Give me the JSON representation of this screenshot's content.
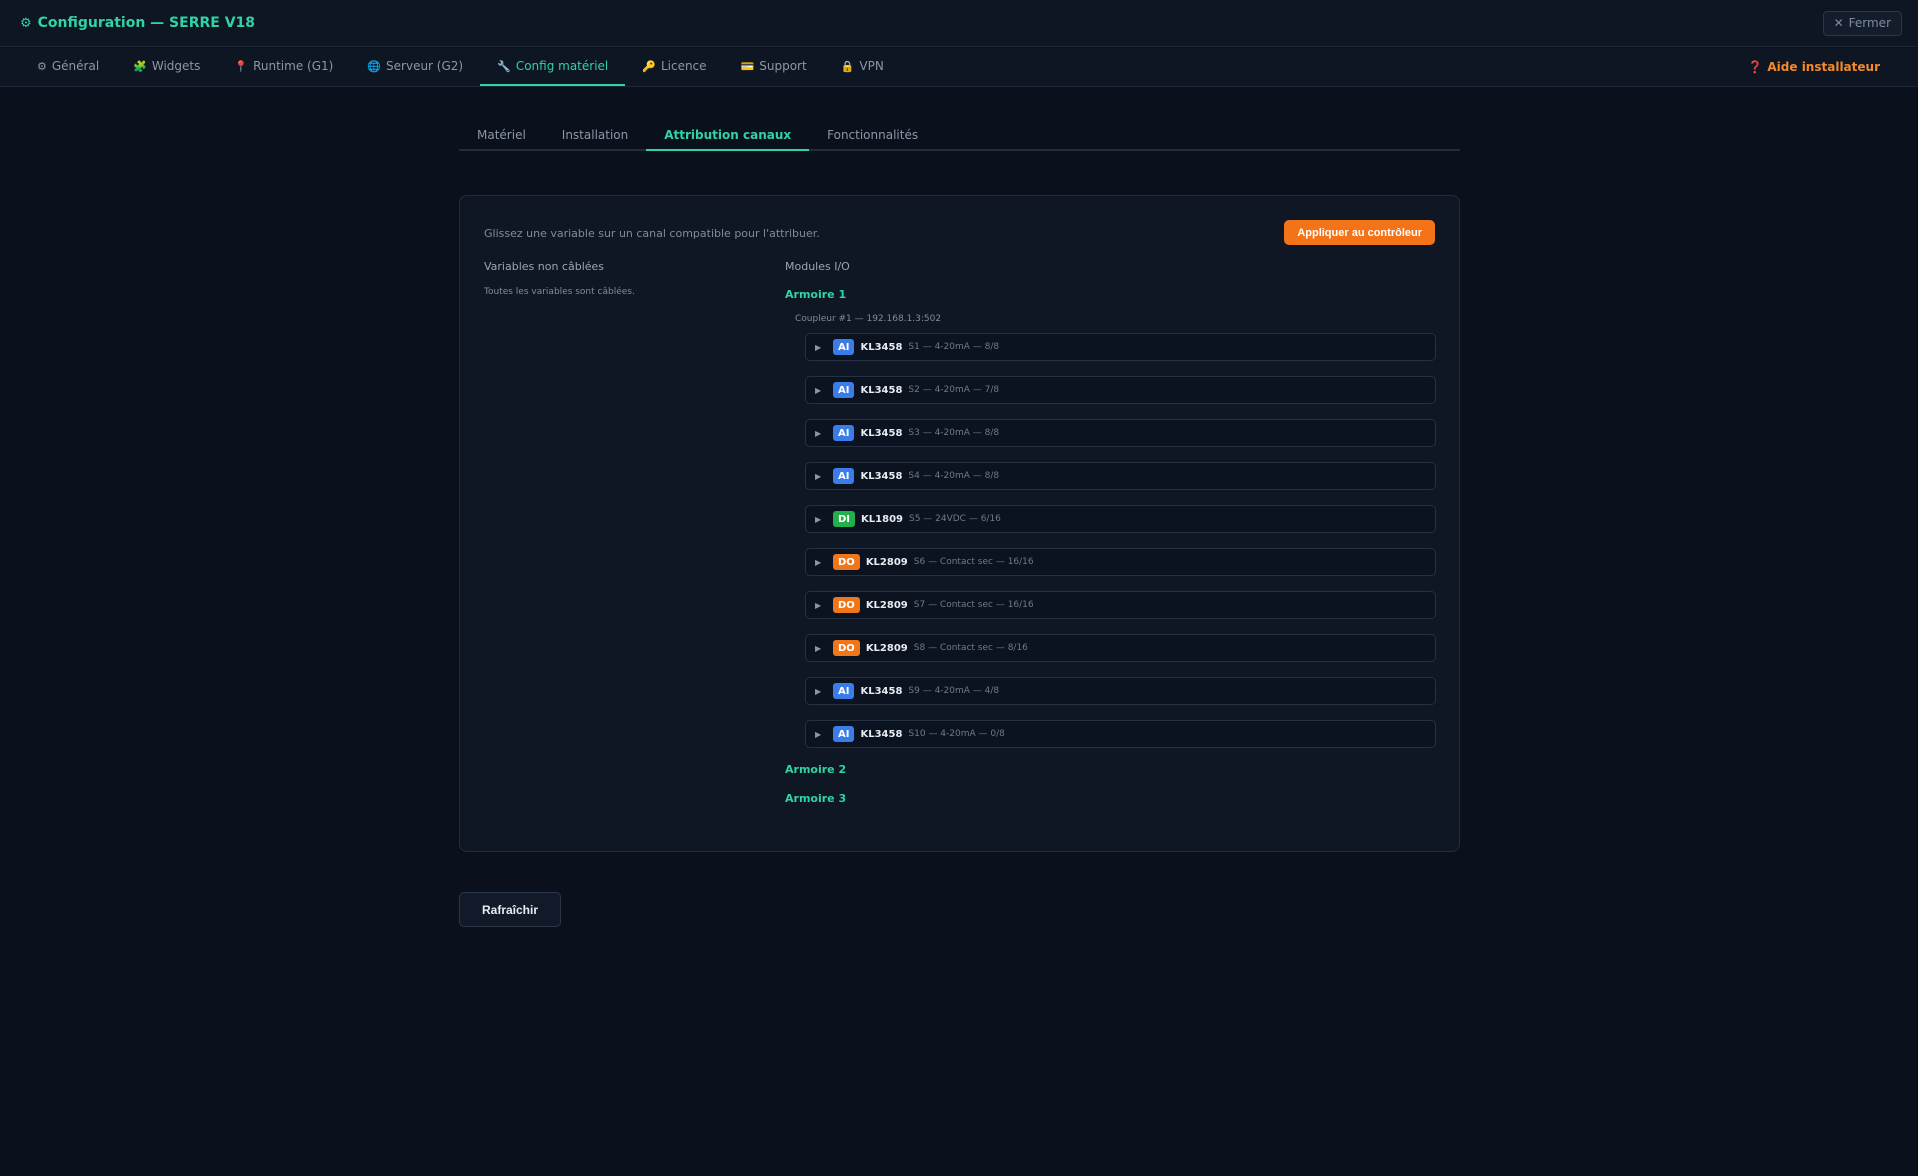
{
  "header": {
    "title": "Configuration — SERRE V18",
    "title_icon": "⚙",
    "close_label": "Fermer",
    "close_icon": "✕"
  },
  "topnav": {
    "tabs": [
      {
        "icon": "⚙",
        "label": "Général"
      },
      {
        "icon": "🧩",
        "label": "Widgets"
      },
      {
        "icon": "📍",
        "label": "Runtime (G1)"
      },
      {
        "icon": "🌐",
        "label": "Serveur (G2)"
      },
      {
        "icon": "🔧",
        "label": "Config matériel"
      },
      {
        "icon": "🔑",
        "label": "Licence"
      },
      {
        "icon": "💳",
        "label": "Support"
      },
      {
        "icon": "🔒",
        "label": "VPN"
      }
    ],
    "active_index": 4,
    "help_icon": "❓",
    "help_label": "Aide installateur"
  },
  "subtabs": {
    "tabs": [
      "Matériel",
      "Installation",
      "Attribution canaux",
      "Fonctionnalités"
    ],
    "active_index": 2
  },
  "panel": {
    "hint": "Glissez une variable sur un canal compatible pour l'attribuer.",
    "apply_label": "Appliquer au contrôleur",
    "left_title": "Variables non câblées",
    "left_note": "Toutes les variables sont câblées.",
    "right_title": "Modules I/O",
    "armoires": [
      "Armoire 1",
      "Armoire 2",
      "Armoire 3"
    ],
    "coupler": "Coupleur #1 — 192.168.1.3:502",
    "modules": [
      {
        "type": "AI",
        "ref": "KL3458",
        "desc": "S1 — 4-20mA — 8/8"
      },
      {
        "type": "AI",
        "ref": "KL3458",
        "desc": "S2 — 4-20mA — 7/8"
      },
      {
        "type": "AI",
        "ref": "KL3458",
        "desc": "S3 — 4-20mA — 8/8"
      },
      {
        "type": "AI",
        "ref": "KL3458",
        "desc": "S4 — 4-20mA — 8/8"
      },
      {
        "type": "DI",
        "ref": "KL1809",
        "desc": "S5 — 24VDC — 6/16"
      },
      {
        "type": "DO",
        "ref": "KL2809",
        "desc": "S6 — Contact sec — 16/16"
      },
      {
        "type": "DO",
        "ref": "KL2809",
        "desc": "S7 — Contact sec — 16/16"
      },
      {
        "type": "DO",
        "ref": "KL2809",
        "desc": "S8 — Contact sec — 8/16"
      },
      {
        "type": "AI",
        "ref": "KL3458",
        "desc": "S9 — 4-20mA — 4/8"
      },
      {
        "type": "AI",
        "ref": "KL3458",
        "desc": "S10 — 4-20mA — 0/8"
      }
    ],
    "caret_icon": "▶"
  },
  "refresh_label": "Rafraîchir",
  "colors": {
    "accent": "#2fd3a4",
    "orange": "#f47318",
    "AI": "#3b7de8",
    "DI": "#22b04b",
    "DO": "#f0761a"
  }
}
